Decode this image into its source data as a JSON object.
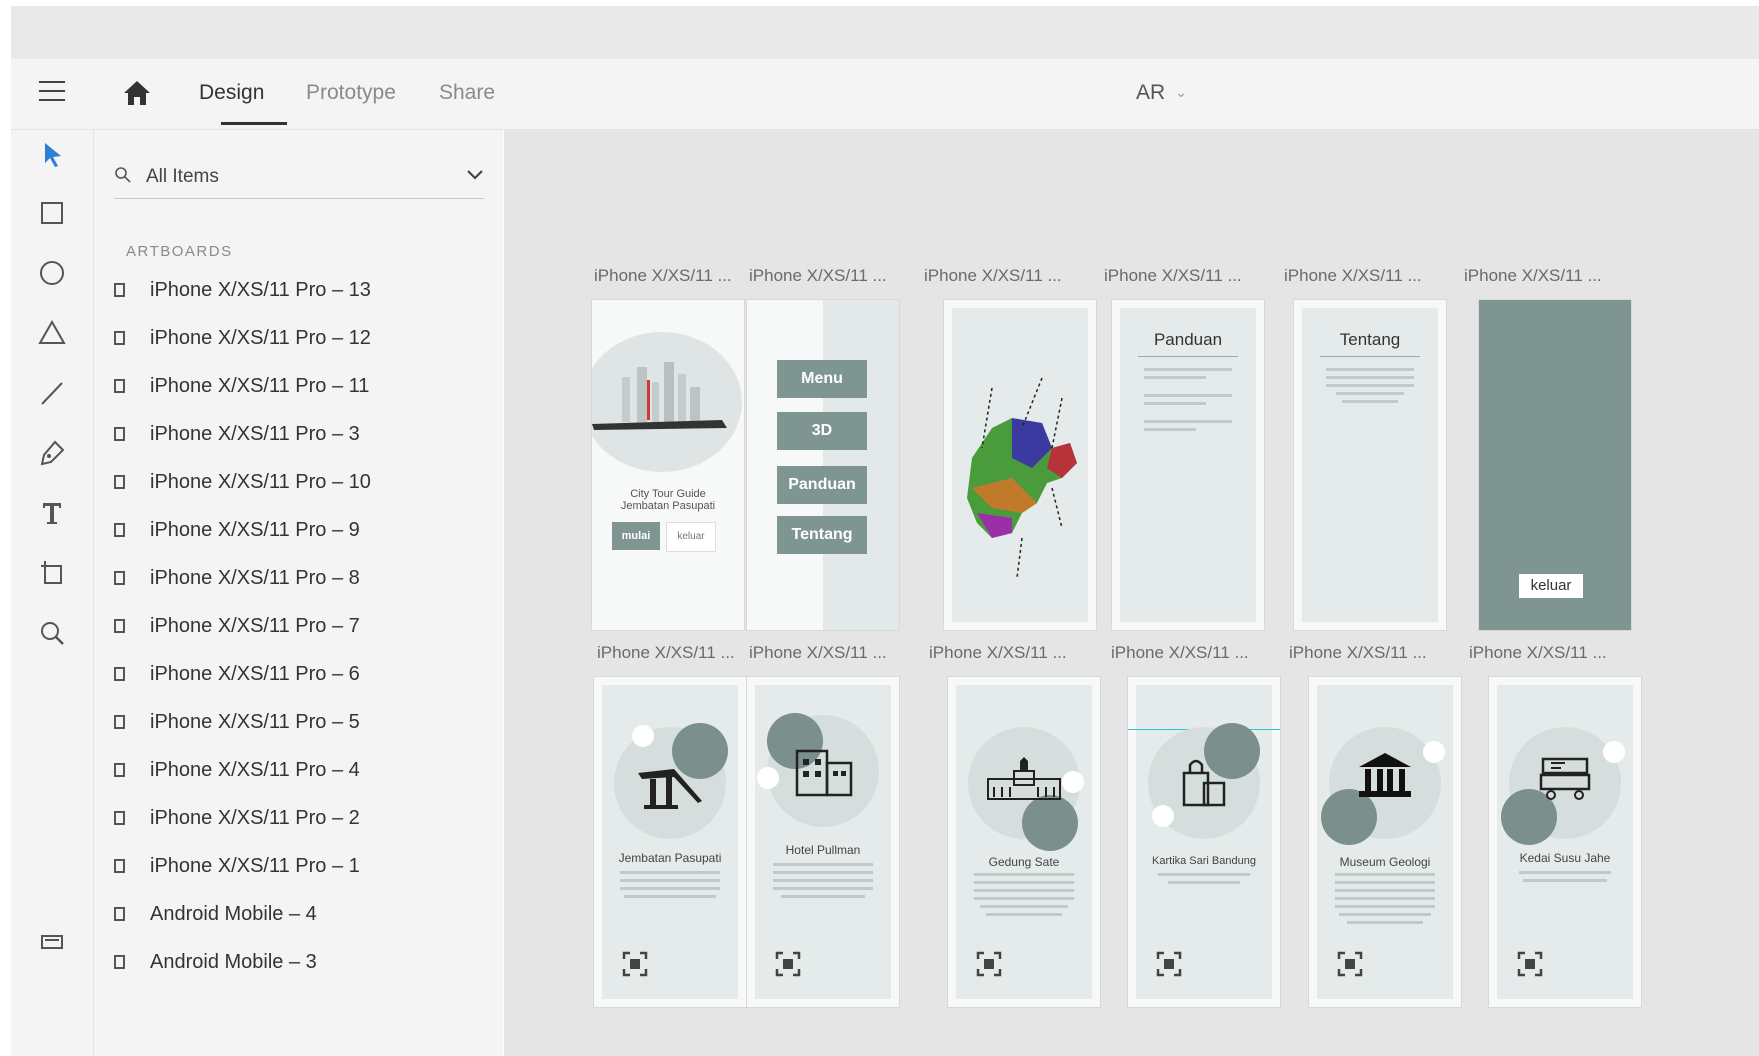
{
  "topbar": {
    "tabs": [
      {
        "label": "Design",
        "active": true
      },
      {
        "label": "Prototype",
        "active": false
      },
      {
        "label": "Share",
        "active": false
      }
    ],
    "locale": "AR"
  },
  "tools": [
    "select-tool-icon",
    "rectangle-tool-icon",
    "ellipse-tool-icon",
    "triangle-tool-icon",
    "line-tool-icon",
    "pen-tool-icon",
    "text-tool-icon",
    "artboard-tool-icon",
    "zoom-tool-icon"
  ],
  "sidebar": {
    "filter_label": "All Items",
    "section_label": "ARTBOARDS",
    "items": [
      "iPhone X/XS/11 Pro – 13",
      "iPhone X/XS/11 Pro – 12",
      "iPhone X/XS/11 Pro – 11",
      "iPhone X/XS/11 Pro – 3",
      "iPhone X/XS/11 Pro – 10",
      "iPhone X/XS/11 Pro – 9",
      "iPhone X/XS/11 Pro – 8",
      "iPhone X/XS/11 Pro – 7",
      "iPhone X/XS/11 Pro – 6",
      "iPhone X/XS/11 Pro – 5",
      "iPhone X/XS/11 Pro – 4",
      "iPhone X/XS/11 Pro – 2",
      "iPhone X/XS/11 Pro – 1",
      "Android Mobile – 4",
      "Android Mobile – 3"
    ]
  },
  "artboard_title": "iPhone X/XS/11 ...",
  "screens": {
    "splash": {
      "line1": "City Tour Guide",
      "line2": "Jembatan Pasupati",
      "start": "mulai",
      "exit": "keluar"
    },
    "menu": [
      "Menu",
      "3D",
      "Panduan",
      "Tentang"
    ],
    "panduan": "Panduan",
    "tentang": "Tentang",
    "exit": "keluar",
    "places": [
      "Jembatan Pasupati",
      "Hotel Pullman",
      "Gedung Sate",
      "Kartika Sari Bandung",
      "Museum Geologi",
      "Kedai Susu Jahe"
    ]
  },
  "colors": {
    "accent": "#2d7fd6",
    "sage": "#7e9592",
    "canvas": "#e5e5e5",
    "panel": "#f4f4f4"
  }
}
